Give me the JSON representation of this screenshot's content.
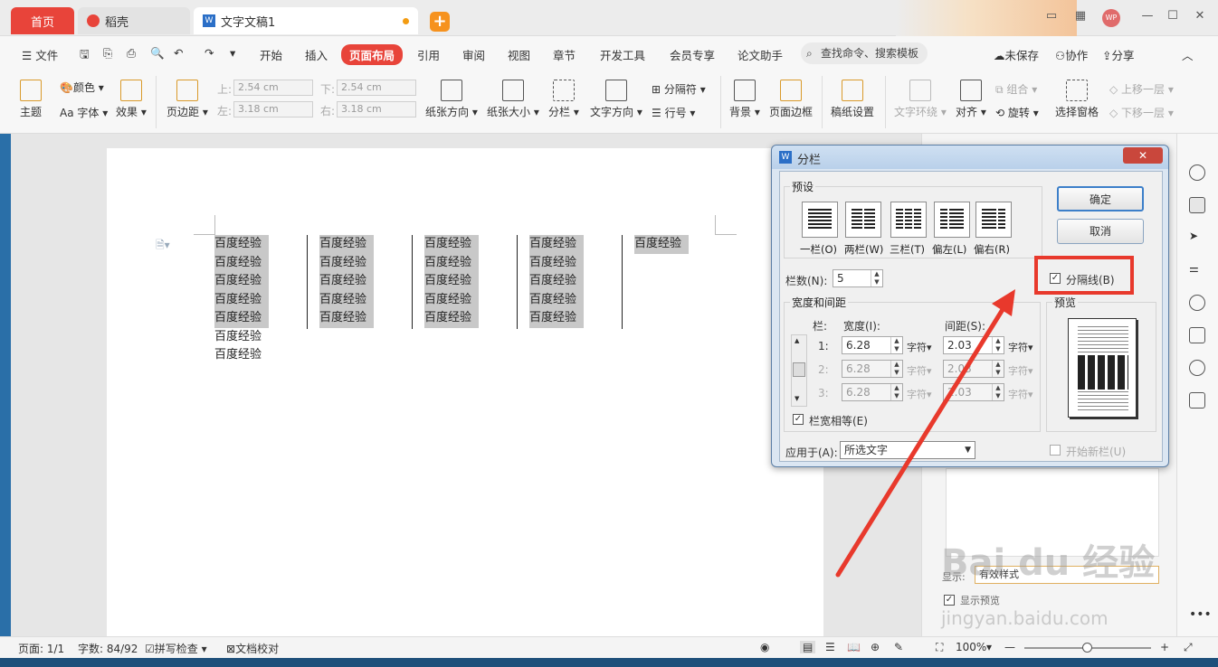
{
  "tabs": {
    "home": "首页",
    "daoke": "稻壳",
    "doc": "文字文稿1"
  },
  "menu": {
    "file": "文件",
    "items": [
      "开始",
      "插入",
      "页面布局",
      "引用",
      "审阅",
      "视图",
      "章节",
      "开发工具",
      "会员专享",
      "论文助手"
    ],
    "active": "页面布局",
    "search": "查找命令、搜索模板",
    "unsaved": "未保存",
    "collab": "协作",
    "share": "分享"
  },
  "ribbon": {
    "theme": "主题",
    "color": "颜色",
    "font": "字体",
    "effect": "效果",
    "margin": "页边距",
    "top_label": "上:",
    "top_val": "2.54 cm",
    "bottom_label": "下:",
    "bottom_val": "2.54 cm",
    "left_label": "左:",
    "left_val": "3.18 cm",
    "right_label": "右:",
    "right_val": "3.18 cm",
    "orientation": "纸张方向",
    "size": "纸张大小",
    "columns": "分栏",
    "text_direction": "文字方向",
    "separator": "分隔符",
    "line_no": "行号",
    "background": "背景",
    "page_border": "页面边框",
    "grid_paper": "稿纸设置",
    "wrap": "文字环绕",
    "align": "对齐",
    "group": "组合",
    "rotate": "旋转",
    "select_pane": "选择窗格",
    "move_up": "上移一层",
    "move_down": "下移一层"
  },
  "document": {
    "columns": [
      [
        "百度经验",
        "百度经验",
        "百度经验",
        "百度经验",
        "百度经验",
        "百度经验",
        "百度经验"
      ],
      [
        "百度经验",
        "百度经验",
        "百度经验",
        "百度经验",
        "百度经验"
      ],
      [
        "百度经验",
        "百度经验",
        "百度经验",
        "百度经验",
        "百度经验"
      ],
      [
        "百度经验",
        "百度经验",
        "百度经验",
        "百度经验",
        "百度经验"
      ],
      [
        "百度经验"
      ]
    ]
  },
  "side_panel": {
    "label": "显示:",
    "select": "有效样式",
    "preview_label": "显示预览"
  },
  "dialog": {
    "title": "分栏",
    "presets_label": "预设",
    "presets": [
      "一栏(O)",
      "两栏(W)",
      "三栏(T)",
      "偏左(L)",
      "偏右(R)"
    ],
    "ok": "确定",
    "cancel": "取消",
    "num_cols_label": "栏数(N):",
    "num_cols": "5",
    "separator_label": "分隔线(B)",
    "separator_checked": true,
    "width_spacing_label": "宽度和间距",
    "col_header": "栏:",
    "width_header": "宽度(I):",
    "spacing_header": "间距(S):",
    "unit": "字符",
    "rows": [
      {
        "n": "1:",
        "width": "6.28",
        "spacing": "2.03"
      },
      {
        "n": "2:",
        "width": "6.28",
        "spacing": "2.03"
      },
      {
        "n": "3:",
        "width": "6.28",
        "spacing": "2.03"
      }
    ],
    "equal_width": "栏宽相等(E)",
    "preview_label": "预览",
    "apply_label": "应用于(A):",
    "apply_value": "所选文字",
    "new_col": "开始新栏(U)"
  },
  "status": {
    "page": "页面: 1/1",
    "words": "字数: 84/92",
    "spell": "拼写检查",
    "proof": "文档校对",
    "zoom": "100%"
  },
  "watermark": {
    "main": "Bai du 经验",
    "url": "jingyan.baidu.com"
  },
  "colors": {
    "accent": "#e8443a",
    "highlight": "#e8392c",
    "dialog_bg": "#f0f0f0"
  }
}
